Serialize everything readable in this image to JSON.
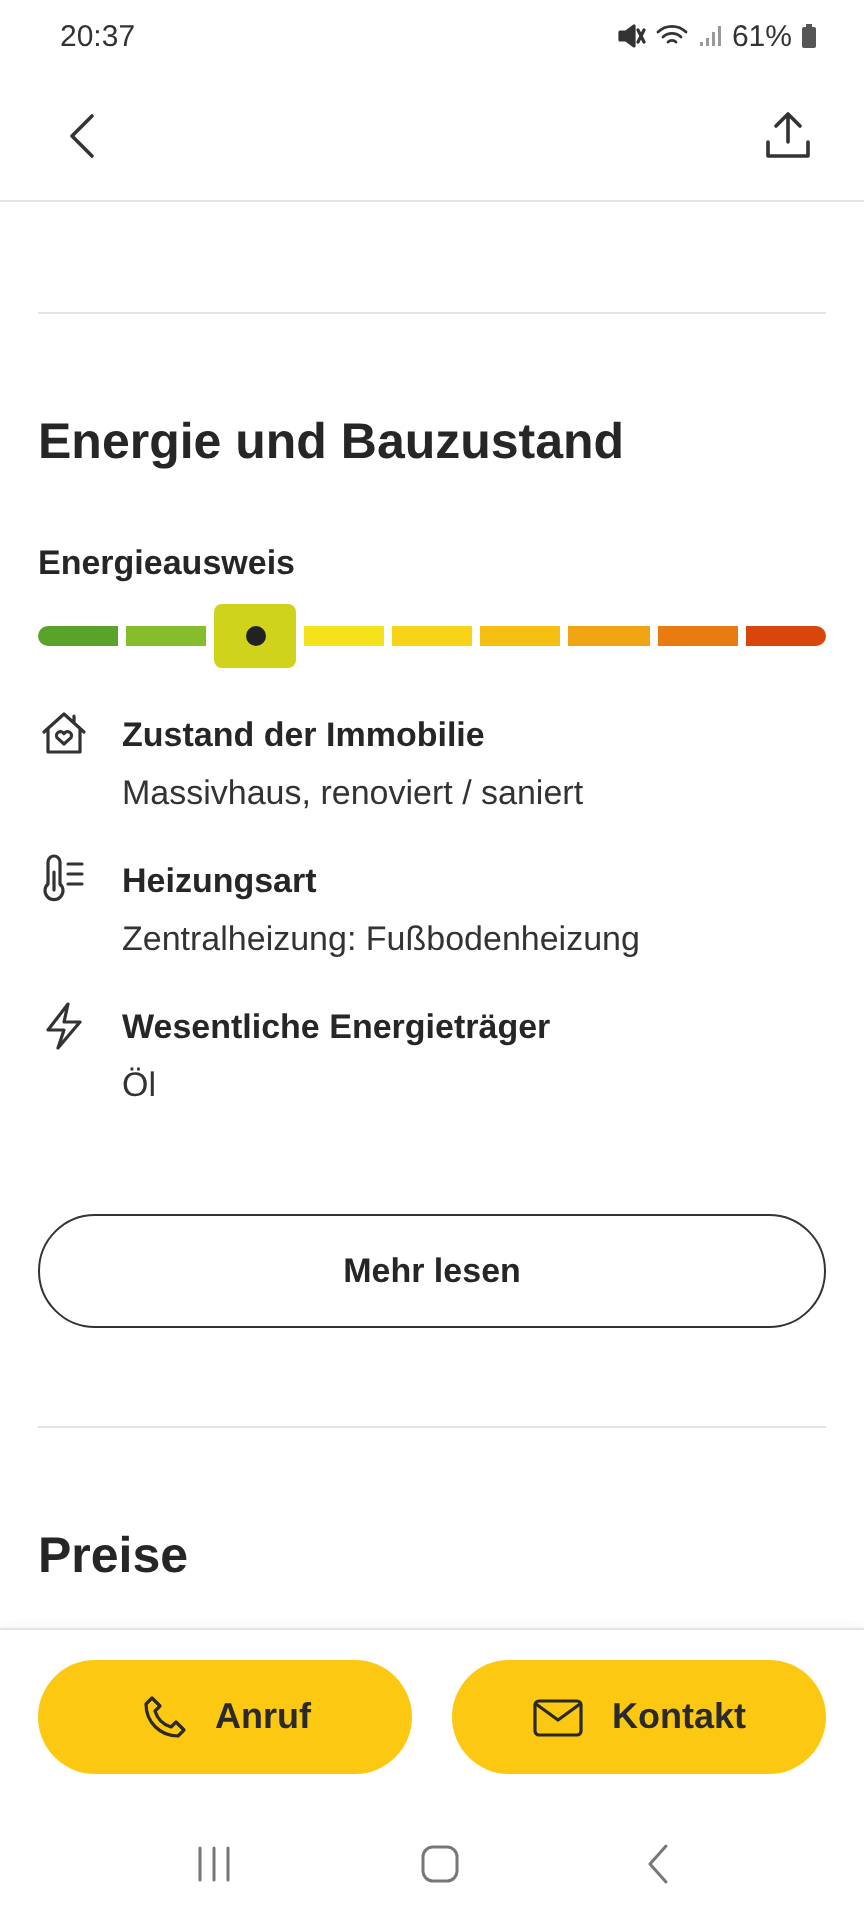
{
  "status_bar": {
    "time": "20:37",
    "battery": "61%"
  },
  "energy_section": {
    "title": "Energie und Bauzustand",
    "certificate_label": "Energieausweis",
    "scale": [
      {
        "color": "#5aa32a",
        "selected": false
      },
      {
        "color": "#86bd2c",
        "selected": false
      },
      {
        "color": "#cfd31c",
        "selected": true
      },
      {
        "color": "#f6e21a",
        "selected": false
      },
      {
        "color": "#f7d417",
        "selected": false
      },
      {
        "color": "#f5c012",
        "selected": false
      },
      {
        "color": "#f0a413",
        "selected": false
      },
      {
        "color": "#e97c10",
        "selected": false
      },
      {
        "color": "#d9460c",
        "selected": false
      }
    ],
    "details": [
      {
        "kind": "house",
        "label": "Zustand der Immobilie",
        "value": "Massivhaus, renoviert / saniert"
      },
      {
        "kind": "thermometer",
        "label": "Heizungsart",
        "value": "Zentralheizung: Fußbodenheizung"
      },
      {
        "kind": "bolt",
        "label": "Wesentliche Energieträger",
        "value": "Öl"
      }
    ],
    "more_button": "Mehr lesen"
  },
  "next_section": {
    "title": "Preise"
  },
  "actions": [
    {
      "kind": "phone",
      "label": "Anruf"
    },
    {
      "kind": "mail",
      "label": "Kontakt"
    }
  ]
}
